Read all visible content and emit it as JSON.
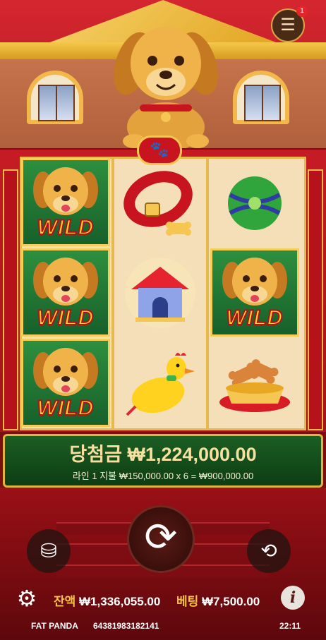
{
  "header": {
    "menu_icon": "hamburger-menu-icon",
    "notification_count": "1"
  },
  "reels": {
    "columns": [
      [
        {
          "symbol": "wild-dog",
          "label": "WILD"
        },
        {
          "symbol": "wild-dog",
          "label": "WILD"
        },
        {
          "symbol": "wild-dog",
          "label": "WILD"
        }
      ],
      [
        {
          "symbol": "red-collar",
          "label": ""
        },
        {
          "symbol": "dog-house",
          "label": ""
        },
        {
          "symbol": "rubber-chicken",
          "label": ""
        }
      ],
      [
        {
          "symbol": "green-ball",
          "label": ""
        },
        {
          "symbol": "wild-dog",
          "label": "WILD"
        },
        {
          "symbol": "bone-bowl",
          "label": ""
        }
      ]
    ]
  },
  "win": {
    "label": "당첨금",
    "amount": "₩1,224,000.00",
    "line_text": "라인 1 지불 ₩150,000.00 x 6 = ₩900,000.00"
  },
  "controls": {
    "stack_icon": "coin-stack-icon",
    "spin_icon": "spin-arrows-icon",
    "autoplay_icon": "autoplay-icon",
    "settings_icon": "gear-icon",
    "info_icon": "info-icon"
  },
  "balance": {
    "label": "잔액",
    "value": "₩1,336,055.00"
  },
  "bet": {
    "label": "베팅",
    "value": "₩7,500.00"
  },
  "footer": {
    "brand": "FAT PANDA",
    "round_id": "64381983182141",
    "time": "22:11"
  },
  "colors": {
    "accent": "#f5c34a",
    "frame_red": "#c61b24",
    "wild_green": "#2d8f3e"
  }
}
